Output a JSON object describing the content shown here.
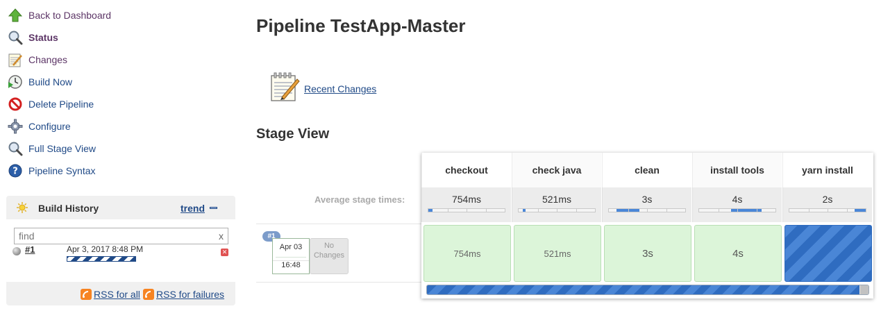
{
  "sidebar": {
    "tasks": [
      {
        "label": "Back to Dashboard",
        "icon": "up-arrow-icon"
      },
      {
        "label": "Status",
        "icon": "magnifier-icon"
      },
      {
        "label": "Changes",
        "icon": "notepad-icon"
      },
      {
        "label": "Build Now",
        "icon": "clock-play-icon"
      },
      {
        "label": "Delete Pipeline",
        "icon": "no-entry-icon"
      },
      {
        "label": "Configure",
        "icon": "gear-icon"
      },
      {
        "label": "Full Stage View",
        "icon": "magnifier-icon"
      },
      {
        "label": "Pipeline Syntax",
        "icon": "help-icon"
      }
    ]
  },
  "build_history": {
    "title": "Build History",
    "trend_label": "trend",
    "search_placeholder": "find",
    "search_clear": "x",
    "builds": [
      {
        "number": "#1",
        "date": "Apr 3, 2017 8:48 PM",
        "status": "running"
      }
    ],
    "rss_all": "RSS for all",
    "rss_failures": "RSS for failures"
  },
  "main": {
    "title": "Pipeline TestApp-Master",
    "recent_changes": "Recent Changes",
    "stage_view_title": "Stage View",
    "avg_label": "Average stage times:"
  },
  "stage_view": {
    "stages": [
      {
        "name": "checkout",
        "avg": "754ms",
        "avg_fraction": 0.05,
        "run_value": "754ms",
        "status": "success"
      },
      {
        "name": "check java",
        "avg": "521ms",
        "avg_fraction": 0.04,
        "run_value": "521ms",
        "status": "success"
      },
      {
        "name": "clean",
        "avg": "3s",
        "avg_fraction": 0.3,
        "run_value": "3s",
        "status": "success"
      },
      {
        "name": "install tools",
        "avg": "4s",
        "avg_fraction": 0.4,
        "run_value": "4s",
        "status": "success"
      },
      {
        "name": "yarn install",
        "avg": "2s",
        "avg_fraction": 0.15,
        "run_value": "",
        "status": "running"
      }
    ],
    "run": {
      "badge": "#1",
      "date": "Apr 03",
      "time": "16:48",
      "changes": "No Changes",
      "progress_fraction": 0.98
    }
  },
  "colors": {
    "link": "#204A87",
    "visited": "#5c3566",
    "success_bg": "#dcf5d9",
    "running": "#2f6cc0"
  }
}
